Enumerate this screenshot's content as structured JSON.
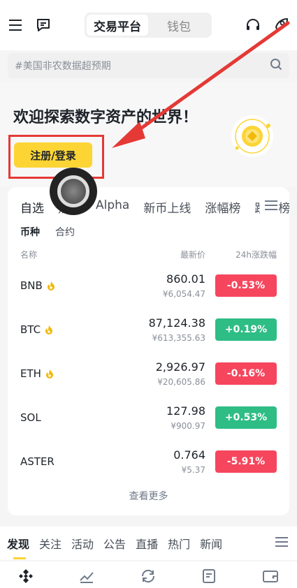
{
  "header": {
    "tabs": [
      {
        "label": "交易平台",
        "active": true
      },
      {
        "label": "钱包",
        "active": false
      }
    ],
    "icons": [
      "menu-icon",
      "chat-icon",
      "headset-icon",
      "profile-icon"
    ]
  },
  "search": {
    "placeholder": "#美国非农数据超预期",
    "icon": "search-icon"
  },
  "hero": {
    "title": "欢迎探索数字资产的世界！",
    "register_label": "注册/登录"
  },
  "market": {
    "tabs": [
      "自选",
      "热门",
      "Alpha",
      "新币上线",
      "涨幅榜",
      "跌幅榜"
    ],
    "active_tab": "自选",
    "subtabs": [
      "币种",
      "合约"
    ],
    "columns": {
      "name": "名称",
      "price": "最新价",
      "change": "24h涨跌幅"
    },
    "rows": [
      {
        "symbol": "BNB",
        "flame": true,
        "price": "860.01",
        "fiat": "¥6,054.47",
        "change": "-0.53%",
        "direction": "down"
      },
      {
        "symbol": "BTC",
        "flame": true,
        "price": "87,124.38",
        "fiat": "¥613,355.63",
        "change": "+0.19%",
        "direction": "up"
      },
      {
        "symbol": "ETH",
        "flame": true,
        "price": "2,926.97",
        "fiat": "¥20,605.86",
        "change": "-0.16%",
        "direction": "down"
      },
      {
        "symbol": "SOL",
        "flame": false,
        "price": "127.98",
        "fiat": "¥900.97",
        "change": "+0.53%",
        "direction": "up"
      },
      {
        "symbol": "ASTER",
        "flame": false,
        "price": "0.764",
        "fiat": "¥5.37",
        "change": "-5.91%",
        "direction": "down"
      }
    ],
    "more_label": "查看更多"
  },
  "feed": {
    "tabs": [
      "发现",
      "关注",
      "活动",
      "公告",
      "直播",
      "热门",
      "新闻"
    ]
  },
  "bottom_nav": [
    "home-icon",
    "markets-icon",
    "trade-icon",
    "futures-icon",
    "wallet-icon"
  ],
  "colors": {
    "accent": "#fcd535",
    "up": "#2ebd85",
    "down": "#f6465d",
    "annotation": "#e53935"
  }
}
